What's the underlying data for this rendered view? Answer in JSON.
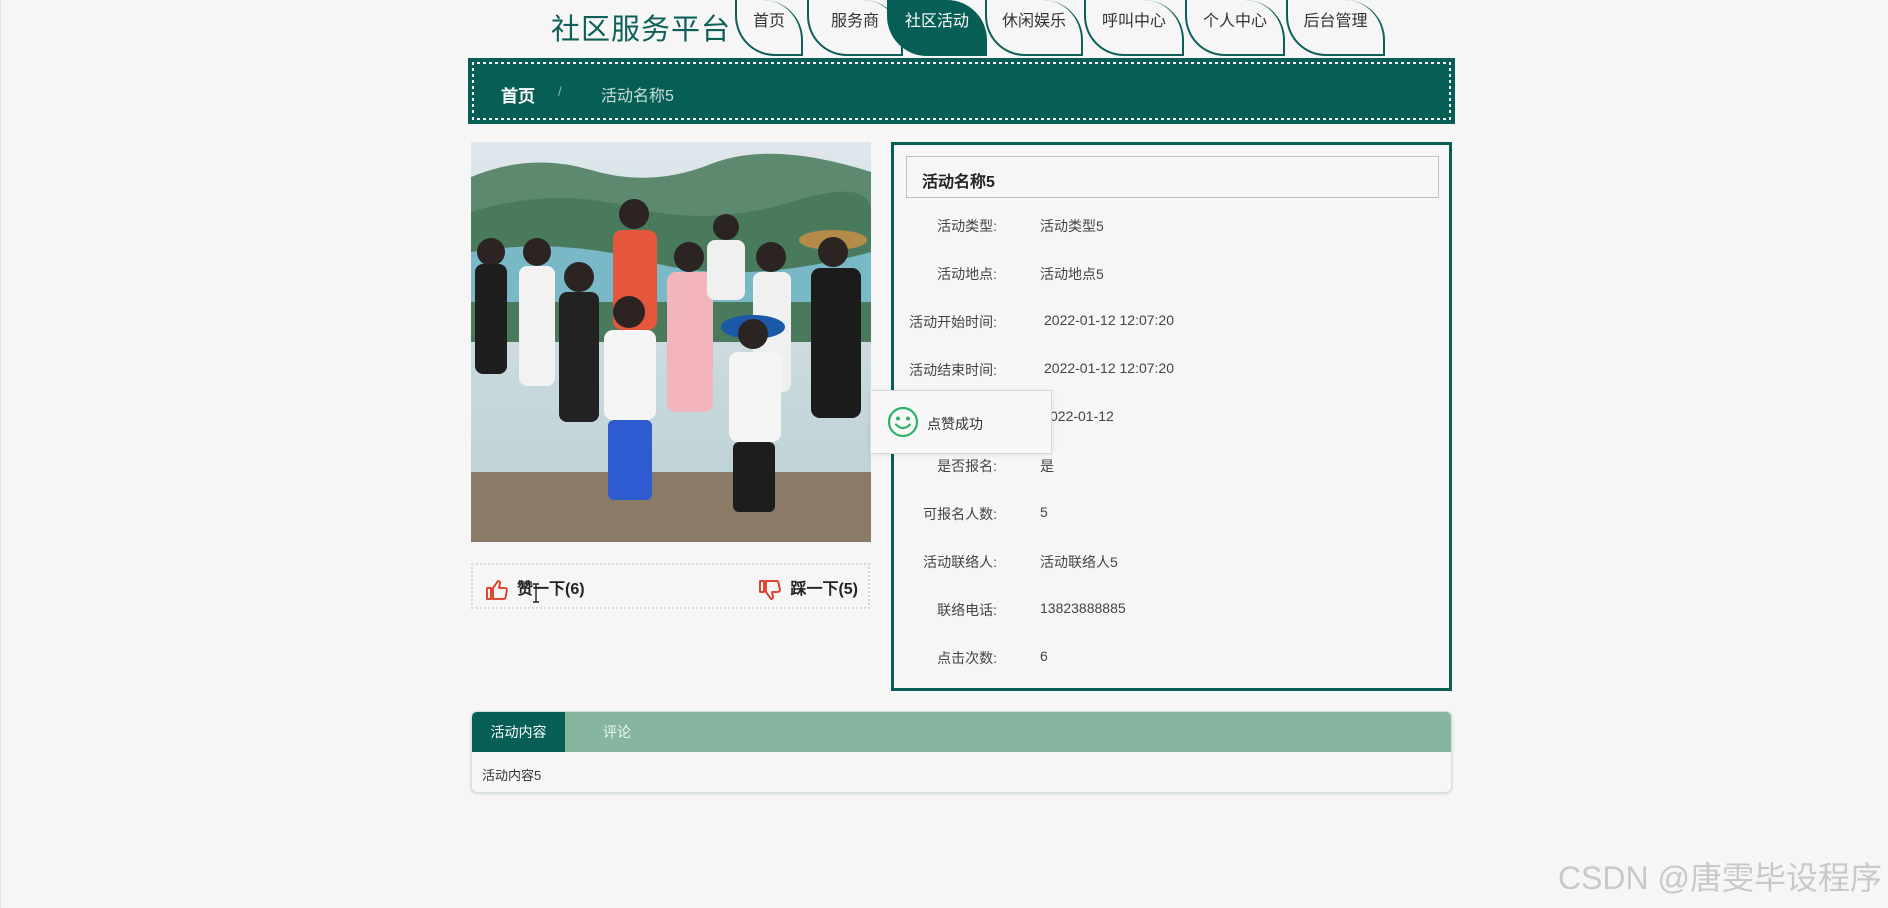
{
  "header": {
    "site_title": "社区服务平台",
    "nav": [
      {
        "label": "首页",
        "active": false
      },
      {
        "label": "服务商",
        "active": false
      },
      {
        "label": "社区活动",
        "active": true
      },
      {
        "label": "休闲娱乐",
        "active": false
      },
      {
        "label": "呼叫中心",
        "active": false
      },
      {
        "label": "个人中心",
        "active": false
      },
      {
        "label": "后台管理",
        "active": false
      }
    ]
  },
  "breadcrumb": {
    "home": "首页",
    "separator": "/",
    "current": "活动名称5"
  },
  "vote": {
    "like_label": "赞一下(6)",
    "dislike_label": "踩一下(5)"
  },
  "detail": {
    "title": "活动名称5",
    "fields": [
      {
        "label": "活动类型:",
        "value": "活动类型5"
      },
      {
        "label": "活动地点:",
        "value": "活动地点5"
      },
      {
        "label": "活动开始时间:",
        "value": "2022-01-12 12:07:20"
      },
      {
        "label": "活动结束时间:",
        "value": "2022-01-12 12:07:20"
      },
      {
        "label": "",
        "value": "022-01-12"
      },
      {
        "label": "是否报名:",
        "value": "是"
      },
      {
        "label": "可报名人数:",
        "value": "5"
      },
      {
        "label": "活动联络人:",
        "value": "活动联络人5"
      },
      {
        "label": "联络电话:",
        "value": "13823888885"
      },
      {
        "label": "点击次数:",
        "value": "6"
      }
    ]
  },
  "toast": {
    "message": "点赞成功",
    "icon": "smile-icon"
  },
  "tabs": {
    "items": [
      {
        "label": "活动内容",
        "active": true
      },
      {
        "label": "评论",
        "active": false
      }
    ],
    "content": "活动内容5"
  },
  "watermark": "CSDN @唐雯毕设程序",
  "colors": {
    "primary": "#075e55",
    "tab_bar": "#86b69f",
    "vote_icon": "#e0321d",
    "toast_icon": "#2db36b"
  }
}
